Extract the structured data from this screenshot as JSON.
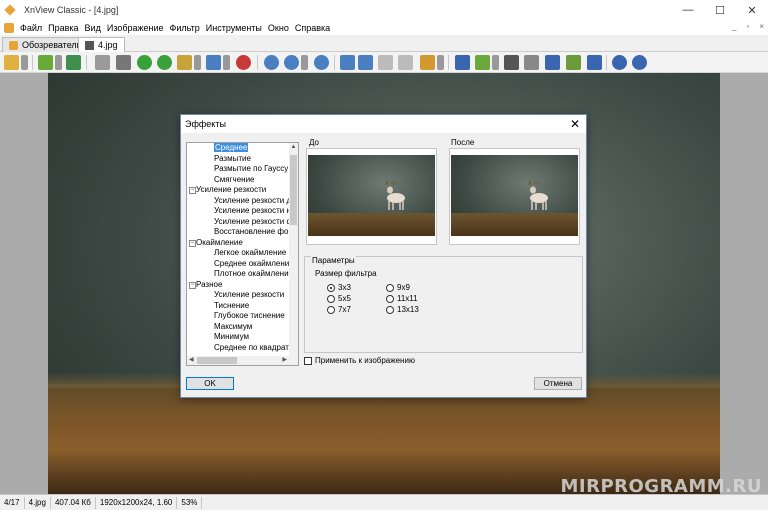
{
  "window": {
    "title": "XnView Classic - [4.jpg]",
    "min": "—",
    "max": "☐",
    "close": "✕"
  },
  "menu": [
    "Файл",
    "Правка",
    "Вид",
    "Изображение",
    "Фильтр",
    "Инструменты",
    "Окно",
    "Справка"
  ],
  "mdi": [
    "_",
    "▫",
    "×"
  ],
  "tabs": [
    {
      "label": "Обозреватель",
      "active": false
    },
    {
      "label": "4.jpg",
      "active": true
    }
  ],
  "dialog": {
    "title": "Эффекты",
    "close": "✕",
    "tree": [
      {
        "type": "leaf",
        "label": "Среднее",
        "selected": true
      },
      {
        "type": "leaf",
        "label": "Размытие"
      },
      {
        "type": "leaf",
        "label": "Размытие по Гауссу"
      },
      {
        "type": "leaf",
        "label": "Смягчение"
      },
      {
        "type": "cat",
        "label": "Усиление резкости"
      },
      {
        "type": "leaf",
        "label": "Усиление резкости де"
      },
      {
        "type": "leaf",
        "label": "Усиление резкости на"
      },
      {
        "type": "leaf",
        "label": "Усиление резкости фо"
      },
      {
        "type": "leaf",
        "label": "Восстановление фоку"
      },
      {
        "type": "cat",
        "label": "Окаймление"
      },
      {
        "type": "leaf",
        "label": "Легкое окаймление кр"
      },
      {
        "type": "leaf",
        "label": "Среднее окаймление к"
      },
      {
        "type": "leaf",
        "label": "Плотное окаймление к"
      },
      {
        "type": "cat",
        "label": "Разное"
      },
      {
        "type": "leaf",
        "label": "Усиление резкости"
      },
      {
        "type": "leaf",
        "label": "Тиснение"
      },
      {
        "type": "leaf",
        "label": "Глубокое тиснение"
      },
      {
        "type": "leaf",
        "label": "Максимум"
      },
      {
        "type": "leaf",
        "label": "Минимум"
      },
      {
        "type": "leaf",
        "label": "Среднее по квадрату"
      }
    ],
    "before_label": "До",
    "after_label": "После",
    "params_title": "Параметры",
    "filter_size_label": "Размер фильтра",
    "radios": [
      {
        "label": "3x3",
        "checked": true
      },
      {
        "label": "5x5",
        "checked": false
      },
      {
        "label": "7x7",
        "checked": false
      },
      {
        "label": "9x9",
        "checked": false
      },
      {
        "label": "11x11",
        "checked": false
      },
      {
        "label": "13x13",
        "checked": false
      }
    ],
    "apply_label": "Применить к изображению",
    "ok": "OK",
    "cancel": "Отмена"
  },
  "status": [
    "4/17",
    "4.jpg",
    "407.04 Кб",
    "1920x1200x24, 1.60",
    "53%"
  ],
  "watermark": "MIRPROGRAMM.RU",
  "colors": {
    "selection": "#3e8ee0",
    "dialog_border": "#6f87a8",
    "app_accent": "#e9a437"
  }
}
